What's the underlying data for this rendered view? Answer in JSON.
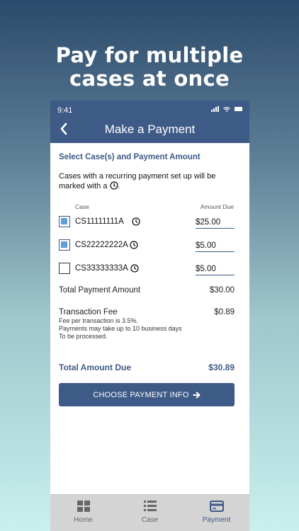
{
  "headline": {
    "line1": "Pay for multiple",
    "line2": "cases at once"
  },
  "status_bar": {
    "time": "9:41"
  },
  "nav": {
    "title": "Make a Payment",
    "back_icon": "chevron-left-icon"
  },
  "section_title": "Select Case(s) and Payment Amount",
  "intro_text": "Cases with a recurring payment set up will be marked with a",
  "intro_suffix": ".",
  "columns": {
    "case": "Case",
    "amount": "Amount Due"
  },
  "cases": [
    {
      "id": "CS11111111A",
      "amount": "$25.00",
      "checked": true,
      "recurring": true
    },
    {
      "id": "CS22222222A",
      "amount": "$5.00",
      "checked": true,
      "recurring": true
    },
    {
      "id": "CS33333333A",
      "amount": "$5.00",
      "checked": false,
      "recurring": true
    }
  ],
  "total_payment": {
    "label": "Total Payment Amount",
    "value": "$30.00"
  },
  "transaction_fee": {
    "label": "Transaction Fee",
    "value": "$0.89",
    "notes": [
      "Fee per transaction is 3.5%.",
      "Payments may take up to 10 business days",
      "To be processed."
    ]
  },
  "total_due": {
    "label": "Total Amount Due",
    "value": "$30.89"
  },
  "pay_button": {
    "label": "CHOOSE PAYMENT INFO",
    "icon": "arrow-right-icon"
  },
  "tabs": [
    {
      "label": "Home",
      "icon": "grid-icon",
      "active": false
    },
    {
      "label": "Case",
      "icon": "list-icon",
      "active": false
    },
    {
      "label": "Payment",
      "icon": "credit-card-icon",
      "active": true
    }
  ],
  "colors": {
    "primary": "#3e5a86",
    "checkbox_fill": "#5c9fd9",
    "tab_bar": "#d4d4d4"
  }
}
